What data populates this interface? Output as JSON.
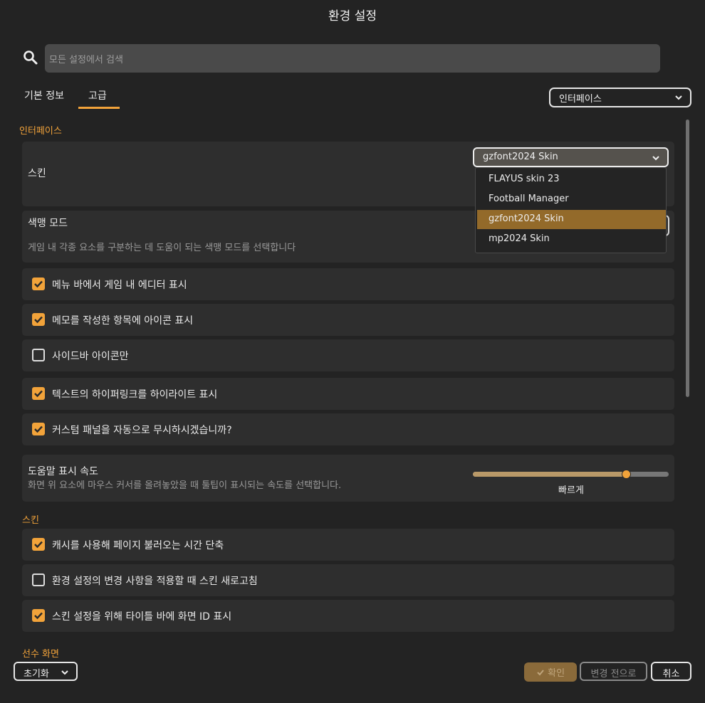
{
  "window": {
    "title": "환경 설정"
  },
  "search": {
    "placeholder": "모든 설정에서 검색"
  },
  "tabs": [
    {
      "label": "기본 정보",
      "active": false
    },
    {
      "label": "고급",
      "active": true
    }
  ],
  "category_dropdown": {
    "value": "인터페이스"
  },
  "sections": {
    "interface": "인터페이스",
    "skin": "스킨",
    "player_screen": "선수 화면"
  },
  "skin_setting": {
    "label": "스킨",
    "selected": "gzfont2024 Skin",
    "options": [
      "FLAYUS skin 23",
      "Football Manager",
      "gzfont2024 Skin",
      "mp2024 Skin"
    ],
    "selected_index": 2
  },
  "colorblind": {
    "label": "색맹 모드",
    "description": "게임 내 각종 요소를 구분하는 데 도움이 되는 색맹 모드를 선택합니다"
  },
  "interface_checkboxes": [
    {
      "label": "메뉴 바에서 게임 내 에디터 표시",
      "checked": true
    },
    {
      "label": "메모를 작성한 항목에 아이콘 표시",
      "checked": true
    },
    {
      "label": "사이드바 아이콘만",
      "checked": false
    },
    {
      "label": "텍스트의 하이퍼링크를 하이라이트 표시",
      "checked": true
    },
    {
      "label": "커스텀 패널을 자동으로 무시하시겠습니까?",
      "checked": true
    }
  ],
  "tooltip_speed": {
    "label": "도움말 표시 속도",
    "description": "화면 위 요소에 마우스 커서를 올려놓았을 때 툴팁이 표시되는 속도를 선택합니다.",
    "value_label": "빠르게",
    "level": 0.78
  },
  "skin_checkboxes": [
    {
      "label": "캐시를 사용해 페이지 불러오는 시간 단축",
      "checked": true
    },
    {
      "label": "환경 설정의 변경 사항을 적용할 때 스킨 새로고침",
      "checked": false
    },
    {
      "label": "스킨 설정을 위해 타이틀 바에 화면 ID 표시",
      "checked": true
    }
  ],
  "footer": {
    "reset": "초기화",
    "ok": "확인",
    "revert": "변경 전으로",
    "cancel": "취소"
  },
  "colors": {
    "accent": "#f2a33a",
    "background": "#232323",
    "card": "#2e2e2e"
  }
}
